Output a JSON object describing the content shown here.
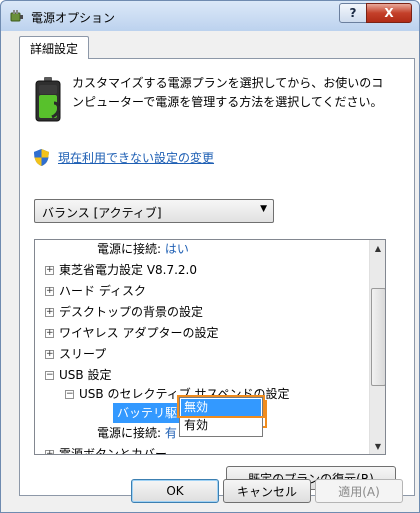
{
  "window": {
    "title": "電源オプション",
    "help_label": "?",
    "close_label": "X"
  },
  "tab": {
    "label": "詳細設定"
  },
  "description": "カスタマイズする電源プランを選択してから、お使いのコンピューターで電源を管理する方法を選択してください。",
  "link": {
    "label": "現在利用できない設定の変更"
  },
  "plan_select": {
    "value": "バランス [アクティブ]"
  },
  "tree": {
    "rows": [
      {
        "kind": "value",
        "label": "電源に接続:",
        "value": "はい"
      },
      {
        "kind": "node",
        "expander": "+",
        "label": "東芝省電力設定 V8.7.2.0"
      },
      {
        "kind": "node",
        "expander": "+",
        "label": "ハード ディスク"
      },
      {
        "kind": "node",
        "expander": "+",
        "label": "デスクトップの背景の設定"
      },
      {
        "kind": "node",
        "expander": "+",
        "label": "ワイヤレス アダプターの設定"
      },
      {
        "kind": "node",
        "expander": "+",
        "label": "スリープ"
      },
      {
        "kind": "node",
        "expander": "−",
        "label": "USB 設定"
      },
      {
        "kind": "node",
        "expander": "−",
        "label": "USB のセレクティブ サスペンドの設定"
      },
      {
        "kind": "value",
        "label": "電源に接続:",
        "value": "有"
      },
      {
        "kind": "node",
        "expander": "+",
        "label": "電源ボタンとカバー"
      }
    ],
    "battery_label": "バッテリ駆動:",
    "combo_value": "有効"
  },
  "dropdown": {
    "options": [
      "無効",
      "有効"
    ]
  },
  "buttons": {
    "restore": "既定のプランの復元(R)",
    "ok": "OK",
    "cancel": "キャンセル",
    "apply": "適用(A)"
  },
  "colors": {
    "highlight": "#3399ff",
    "callout": "#f08c1e",
    "link": "#1e5fb4"
  },
  "icons": {
    "app": "power-plug-icon",
    "battery": "battery-icon",
    "shield": "uac-shield-icon"
  }
}
